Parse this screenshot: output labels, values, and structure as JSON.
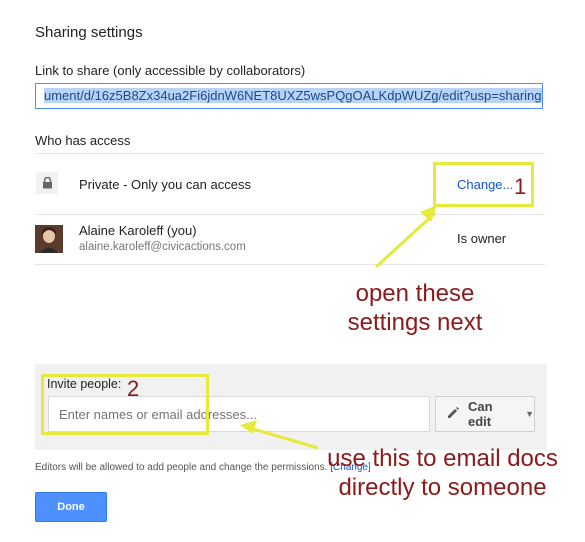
{
  "dialog": {
    "title": "Sharing settings",
    "link_label": "Link to share (only accessible by collaborators)",
    "link_value": "ument/d/16z5B8Zx34ua2Fi6jdnW6NET8UXZ5wsPQgOALKdpWUZg/edit?usp=sharing",
    "who_has_access_label": "Who has access"
  },
  "access": {
    "visibility_text": "Private - Only you can access",
    "change_label": "Change...",
    "user_name": "Alaine Karoleff (you)",
    "user_email": "alaine.karoleff@civicactions.com",
    "user_role": "Is owner"
  },
  "invite": {
    "label": "Invite people:",
    "placeholder": "Enter names or email addresses...",
    "permission_label": "Can edit",
    "note": "Editors will be allowed to add people and change the permissions.",
    "note_link": "[Change]"
  },
  "footer": {
    "done_label": "Done"
  },
  "annotations": {
    "num1": "1",
    "num2": "2",
    "text1_line1": "open these",
    "text1_line2": "settings next",
    "text2_line1": "use this to email docs",
    "text2_line2": "directly to someone",
    "color_box": "#e6ea3c",
    "color_text": "#8b1a1a"
  },
  "icons": [
    "lock-icon",
    "pencil-icon",
    "caret-down-icon"
  ]
}
